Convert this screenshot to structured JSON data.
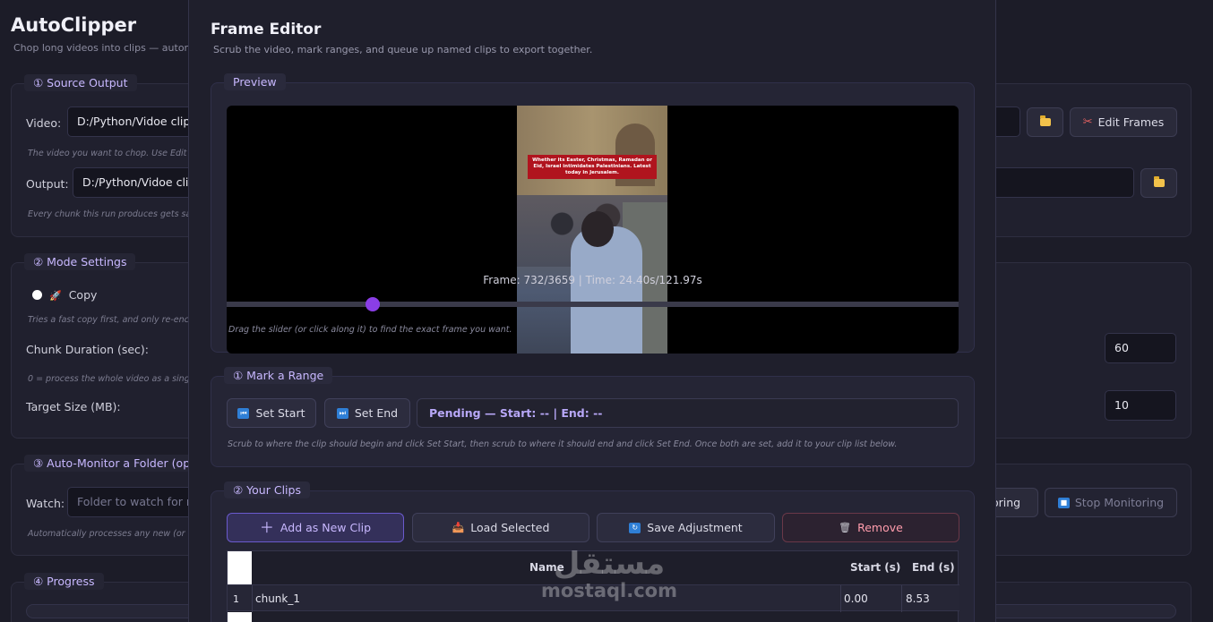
{
  "app": {
    "title": "AutoClipper",
    "subtitle": "Chop long videos into clips — autom"
  },
  "source_output": {
    "title": "① Source  Output",
    "video_label": "Video:",
    "video_value": "D:/Python/Vidoe clipp",
    "video_hint": "The video you want to chop. Use Edit i",
    "output_label": "Output:",
    "output_value": "D:/Python/Vidoe clip",
    "output_hint": "Every chunk this run produces gets sav",
    "edit_frames_label": "Edit Frames"
  },
  "mode_settings": {
    "title": "② Mode  Settings",
    "copy_label": "Copy",
    "copy_hint": "Tries a fast copy first, and only re-enco",
    "chunk_label": "Chunk Duration (sec):",
    "chunk_value": "60",
    "chunk_hint": "0 = process the whole video as a singl",
    "target_label": "Target Size (MB):",
    "target_value": "10"
  },
  "auto_monitor": {
    "title": "③ Auto-Monitor a Folder (op",
    "watch_label": "Watch:",
    "watch_placeholder": "Folder to watch for ne",
    "watch_hint": "Automatically processes any new (or n",
    "start_label": "oring",
    "stop_label": "Stop Monitoring"
  },
  "progress": {
    "title": "④ Progress"
  },
  "editor": {
    "title": "Frame Editor",
    "subtitle": "Scrub the video, mark ranges, and queue up named clips to export together.",
    "preview_title": "Preview",
    "caption_text": "Whether its Easter, Christmas, Ramadan or Eid, Israel intimidates Palestinians. Latest today in Jerusalem.",
    "frame_info": "Frame: 732/3659 | Time: 24.40s/121.97s",
    "slider_fraction": 0.2,
    "slider_hint": "Drag the slider (or click along it) to find the exact frame you want.",
    "range_title": "① Mark a Range",
    "set_start_label": "Set Start",
    "set_end_label": "Set End",
    "pending_text": "Pending — Start: -- | End: --",
    "range_hint": "Scrub to where the clip should begin and click Set Start, then scrub to where it should end and click Set End. Once both are set, add it to your clip list below.",
    "clips_title": "② Your Clips",
    "add_clip_label": "Add as New Clip",
    "load_selected_label": "Load Selected",
    "save_adjustment_label": "Save Adjustment",
    "remove_label": "Remove",
    "columns": [
      "Name",
      "Start (s)",
      "End (s)"
    ],
    "rows": [
      {
        "num": "1",
        "name": "chunk_1",
        "start": "0.00",
        "end": "8.53"
      }
    ]
  },
  "watermark": {
    "arabic": "مستقل",
    "latin": "mostaql.com"
  },
  "colors": {
    "accent": "#8a3ee6",
    "section_title": "#c8b8ff",
    "danger_text": "#ff9cac"
  }
}
